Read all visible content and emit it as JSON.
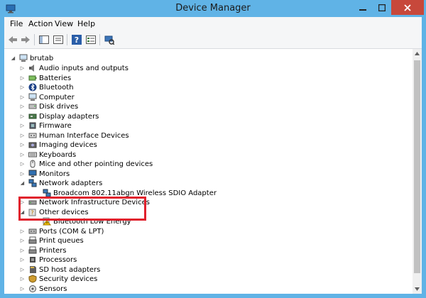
{
  "window": {
    "title": "Device Manager",
    "accent_color": "#60b3e6",
    "close_color": "#c7483b"
  },
  "menu": {
    "items": [
      "File",
      "Action",
      "View",
      "Help"
    ]
  },
  "toolbar": {
    "buttons": [
      "back-icon",
      "forward-icon",
      "show-hide-tree-icon",
      "properties-icon",
      "help-icon",
      "update-driver-icon",
      "scan-hardware-icon"
    ]
  },
  "tree": {
    "root": "brutab",
    "items": [
      {
        "label": "Audio inputs and outputs",
        "icon": "speaker-icon",
        "expanded": false
      },
      {
        "label": "Batteries",
        "icon": "battery-icon",
        "expanded": false
      },
      {
        "label": "Bluetooth",
        "icon": "bluetooth-icon",
        "expanded": false
      },
      {
        "label": "Computer",
        "icon": "computer-icon",
        "expanded": false
      },
      {
        "label": "Disk drives",
        "icon": "disk-icon",
        "expanded": false
      },
      {
        "label": "Display adapters",
        "icon": "display-adapter-icon",
        "expanded": false
      },
      {
        "label": "Firmware",
        "icon": "firmware-icon",
        "expanded": false
      },
      {
        "label": "Human Interface Devices",
        "icon": "hid-icon",
        "expanded": false
      },
      {
        "label": "Imaging devices",
        "icon": "camera-icon",
        "expanded": false
      },
      {
        "label": "Keyboards",
        "icon": "keyboard-icon",
        "expanded": false
      },
      {
        "label": "Mice and other pointing devices",
        "icon": "mouse-icon",
        "expanded": false
      },
      {
        "label": "Monitors",
        "icon": "monitor-icon",
        "expanded": false
      },
      {
        "label": "Network adapters",
        "icon": "network-icon",
        "expanded": true
      },
      {
        "label": "Broadcom 802.11abgn Wireless SDIO Adapter",
        "icon": "network-icon",
        "child": true
      },
      {
        "label": "Network Infrastructure Devices",
        "icon": "network-infra-icon",
        "expanded": false
      },
      {
        "label": "Other devices",
        "icon": "unknown-device-icon",
        "expanded": true
      },
      {
        "label": "Bluetooth Low Energy",
        "icon": "warning-device-icon",
        "child": true
      },
      {
        "label": "Ports (COM & LPT)",
        "icon": "port-icon",
        "expanded": false
      },
      {
        "label": "Print queues",
        "icon": "printer-icon",
        "expanded": false
      },
      {
        "label": "Printers",
        "icon": "printer-icon",
        "expanded": false
      },
      {
        "label": "Processors",
        "icon": "processor-icon",
        "expanded": false
      },
      {
        "label": "SD host adapters",
        "icon": "sd-card-icon",
        "expanded": false
      },
      {
        "label": "Security devices",
        "icon": "security-icon",
        "expanded": false
      },
      {
        "label": "Sensors",
        "icon": "sensor-icon",
        "expanded": false
      }
    ]
  },
  "highlight_color": "#e0202c"
}
